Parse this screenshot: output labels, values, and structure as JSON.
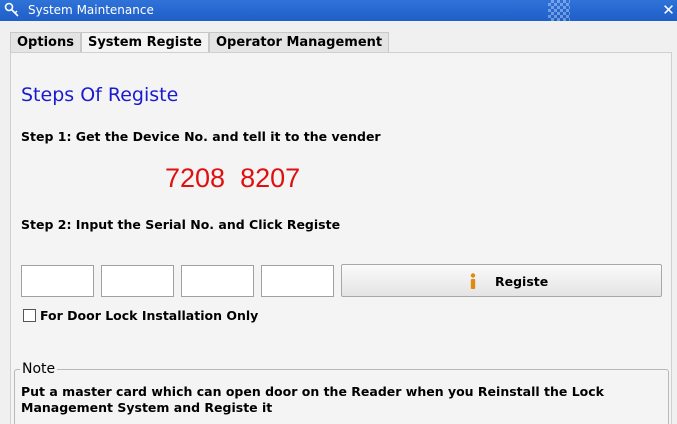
{
  "window": {
    "title": "System Maintenance",
    "icon": "key-icon",
    "close_label": "✕"
  },
  "tabs": [
    {
      "label": "Options",
      "active": false
    },
    {
      "label": "System Registe",
      "active": true
    },
    {
      "label": "Operator Management",
      "active": false
    }
  ],
  "register": {
    "heading": "Steps Of Registe",
    "step1": "Step 1: Get the Device No. and tell it to the vender",
    "device_no": "7208  8207",
    "step2": "Step 2: Input the Serial No. and Click Registe",
    "serial_values": [
      "",
      "",
      "",
      ""
    ],
    "button_label": "Registe",
    "button_icon": "info-icon",
    "checkbox_label": "For Door Lock Installation Only",
    "checkbox_checked": false
  },
  "note": {
    "legend": "Note",
    "text": "Put a master card which can open door on the Reader when you Reinstall the Lock Management System and Registe it"
  },
  "colors": {
    "titlebar": "#2f72d8",
    "heading": "#1a1ad0",
    "device_no": "#e01010"
  }
}
